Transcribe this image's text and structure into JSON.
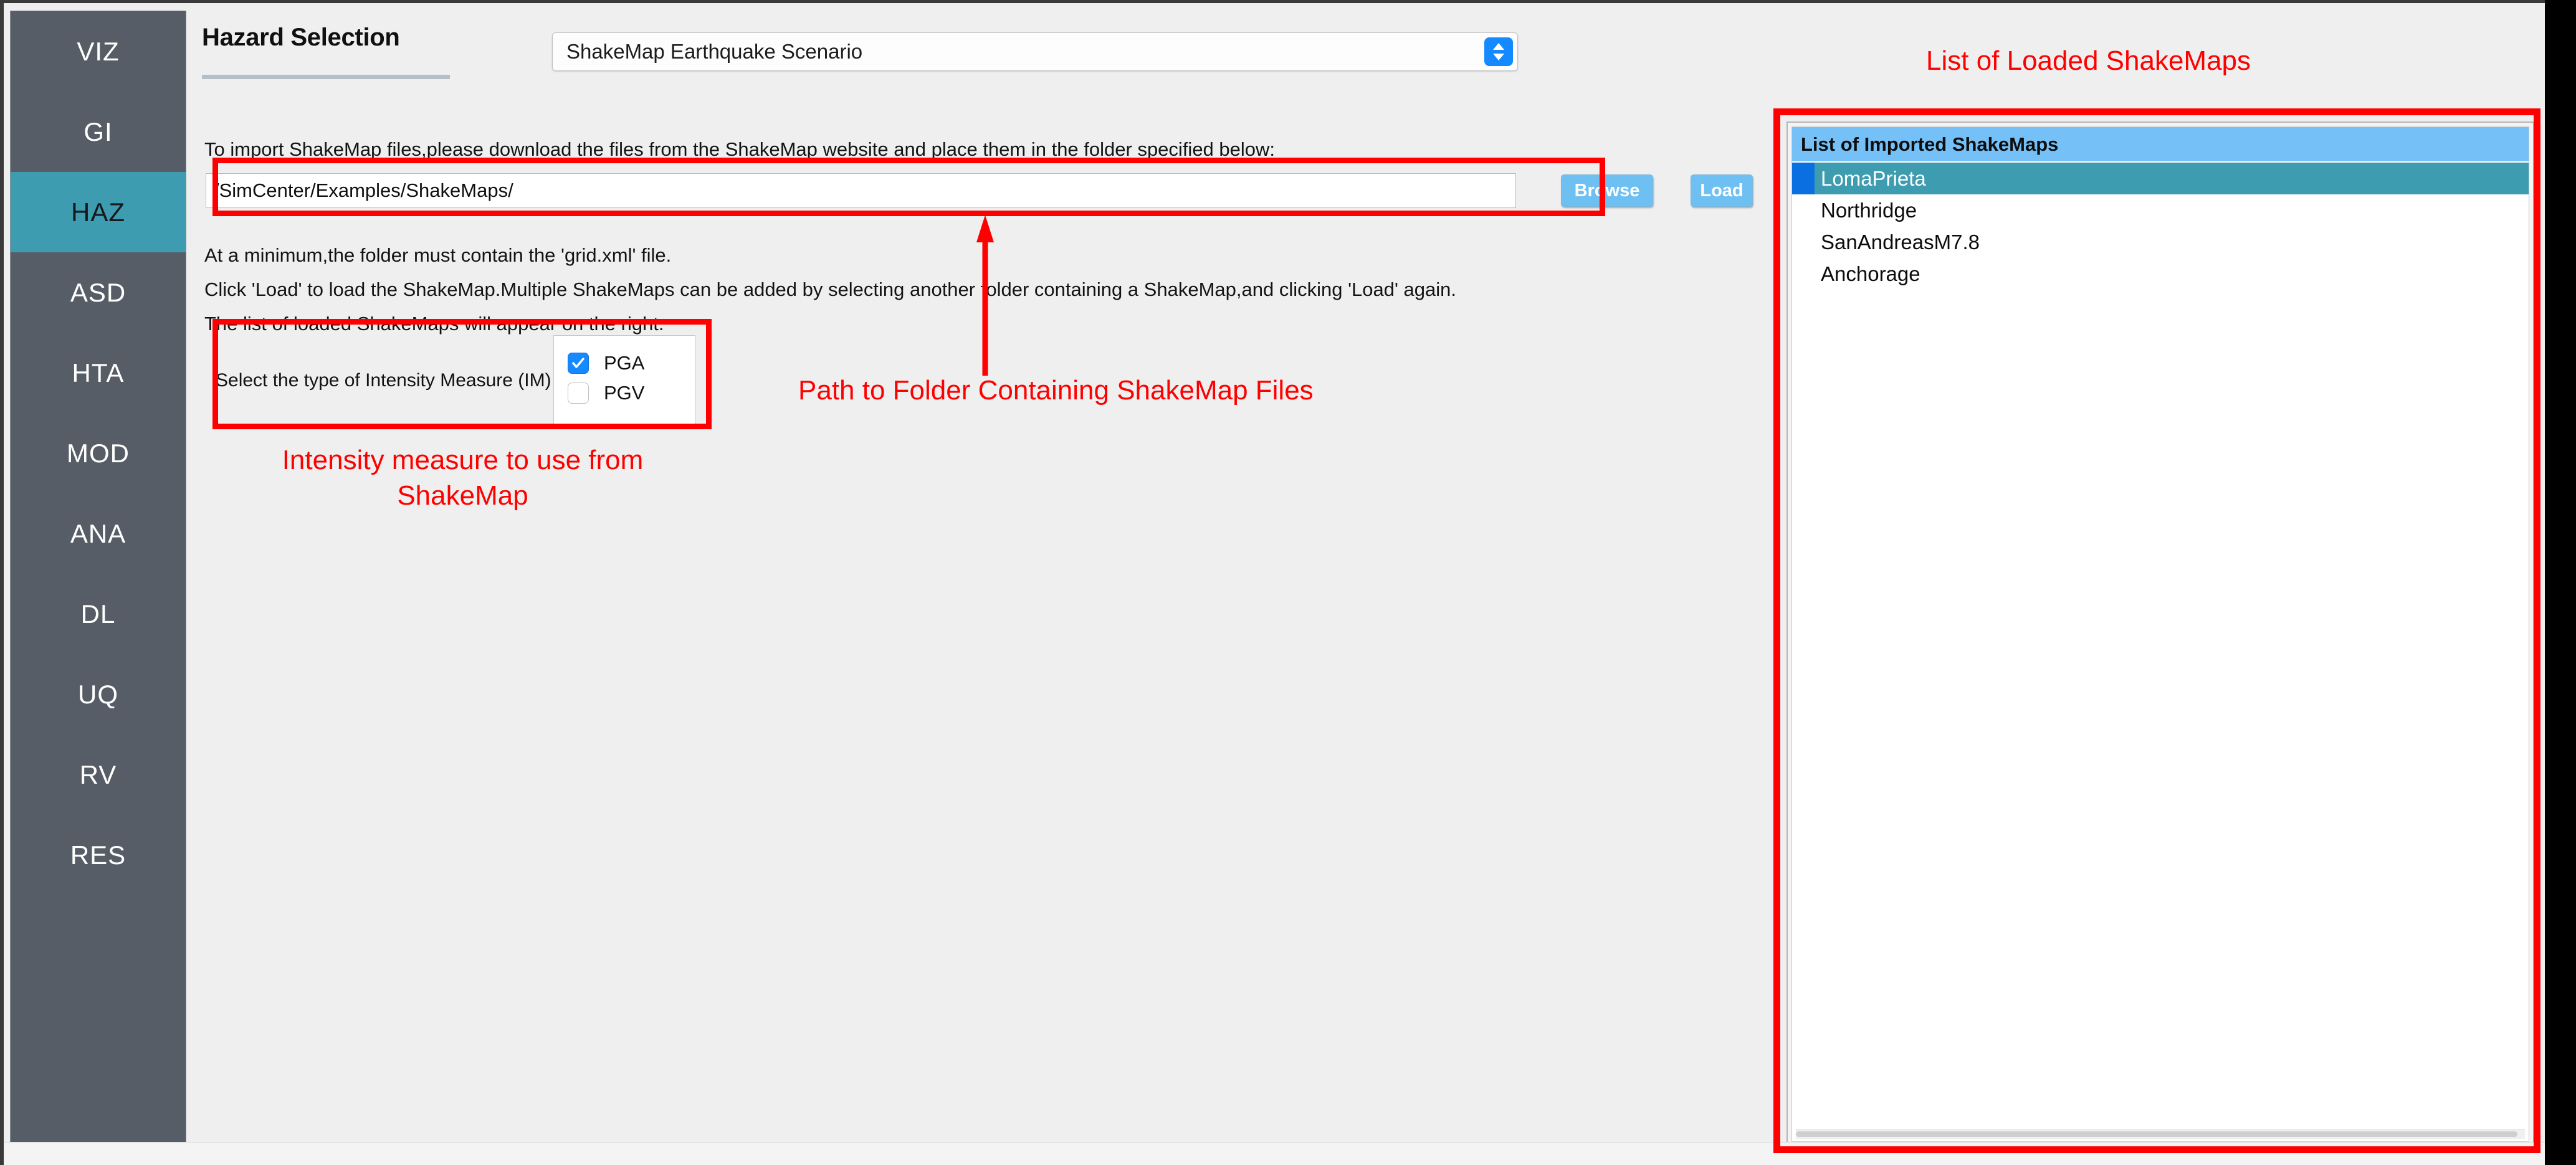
{
  "sidebar": {
    "items": [
      {
        "label": "VIZ",
        "active": false
      },
      {
        "label": "GI",
        "active": false
      },
      {
        "label": "HAZ",
        "active": true
      },
      {
        "label": "ASD",
        "active": false
      },
      {
        "label": "HTA",
        "active": false
      },
      {
        "label": "MOD",
        "active": false
      },
      {
        "label": "ANA",
        "active": false
      },
      {
        "label": "DL",
        "active": false
      },
      {
        "label": "UQ",
        "active": false
      },
      {
        "label": "RV",
        "active": false
      },
      {
        "label": "RES",
        "active": false
      }
    ]
  },
  "header": {
    "title": "Hazard Selection",
    "combo_value": "ShakeMap Earthquake Scenario",
    "combo_icon": "updown-chevron-icon"
  },
  "main": {
    "intro_text": "To import ShakeMap files,please download the files from the ShakeMap website and place them in the folder specified below:",
    "path_value": "/SimCenter/Examples/ShakeMaps/",
    "path_placeholder": "",
    "browse_label": "Browse",
    "load_label": "Load",
    "min_text": "At a minimum,the folder must contain the 'grid.xml' file.",
    "load_text": "Click 'Load' to load the ShakeMap.Multiple ShakeMaps can be added by selecting another folder containing a ShakeMap,and clicking 'Load' again.",
    "appear_text": "The list of loaded ShakeMaps will appear on the right.",
    "im_label": "Select the type of Intensity Measure (IM)",
    "im_options": [
      {
        "label": "PGA",
        "checked": true
      },
      {
        "label": "PGV",
        "checked": false
      }
    ]
  },
  "list_panel": {
    "header": "List of Imported ShakeMaps",
    "rows": [
      {
        "label": "LomaPrieta",
        "selected": true
      },
      {
        "label": "Northridge",
        "selected": false
      },
      {
        "label": "SanAndreasM7.8",
        "selected": false
      },
      {
        "label": "Anchorage",
        "selected": false
      }
    ]
  },
  "annotations": {
    "list_label": "List of Loaded ShakeMaps",
    "path_label": "Path to Folder Containing ShakeMap Files",
    "im_label": "Intensity measure to use from ShakeMap",
    "color": "#ff0000"
  },
  "colors": {
    "sidebar_bg": "#575d66",
    "accent_teal": "#3d9cb0",
    "button_blue": "#6fc0f2",
    "header_blue": "#74c0f7",
    "annotation_red": "#ff0000"
  }
}
